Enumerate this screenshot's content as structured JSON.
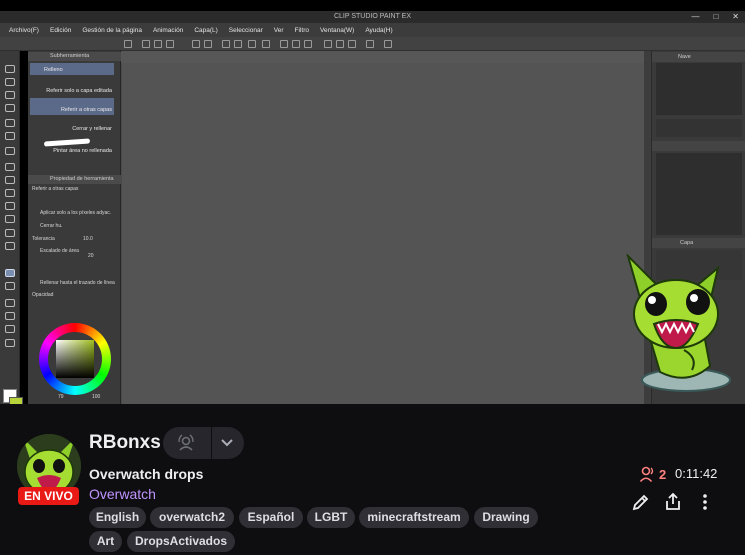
{
  "app_title": "CLIP STUDIO PAINT EX",
  "menu": [
    "Archivo(F)",
    "Edición",
    "Gestión de la página",
    "Animación",
    "Capa(L)",
    "Seleccionar",
    "Ver",
    "Filtro",
    "Ventana(W)",
    "Ayuda(H)"
  ],
  "sub_tool": {
    "header": "Subherramienta",
    "items": [
      "Relleno",
      "Referir solo a capa editada",
      "Referir a otras capas",
      "Cerrar y rellenar",
      "Pintar área no rellenada"
    ]
  },
  "tool_property": {
    "header": "Propiedad de herramienta",
    "subtitle": "Referir a otras capas",
    "rows": [
      "Aplicar solo a los píxeles adyac.",
      "Cerrar hu.",
      "Tolerancia",
      "Escalado de área",
      "Rellenar hasta el trazado de línea",
      "Opacidad"
    ],
    "tolerance_value": "10.0",
    "scale_value": "20"
  },
  "color_bar": {
    "left": "79",
    "right": "100"
  },
  "right_panel": {
    "navigator_label": "Nave",
    "layer_label": "Capa"
  },
  "colors": {
    "accent": "#9147ff",
    "live": "#e91916",
    "viewers": "#ff8280",
    "game": "#bf94ff"
  },
  "stream": {
    "channel_name": "RBonxs",
    "live_badge": "EN VIVO",
    "title": "Overwatch drops",
    "game": "Overwatch",
    "tags": [
      "English",
      "overwatch2",
      "Español",
      "LGBT",
      "minecraftstream",
      "Drawing",
      "Art",
      "DropsActivados"
    ],
    "viewer_count": "2",
    "uptime": "0:11:42"
  },
  "icons": [
    "person-icon",
    "pencil-icon",
    "share-icon",
    "more-vertical-icon",
    "chevron-down-icon",
    "notification-icon"
  ]
}
